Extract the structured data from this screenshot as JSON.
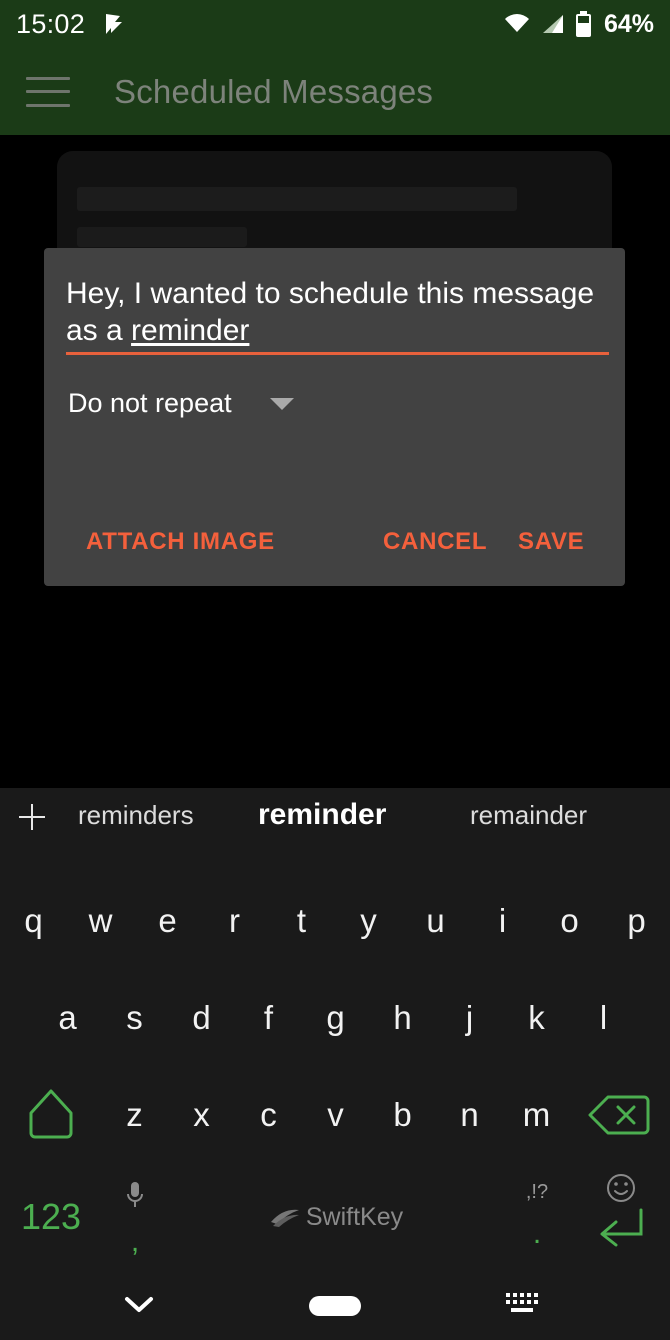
{
  "status_bar": {
    "clock": "15:02",
    "battery_percent": "64%",
    "icons": [
      "notification-flag-icon",
      "wifi-icon",
      "signal-icon",
      "battery-icon"
    ]
  },
  "app_bar": {
    "menu_icon": "hamburger-menu-icon",
    "title": "Scheduled Messages"
  },
  "dialog": {
    "message_text": "Hey, I wanted to schedule this message as a ",
    "composing_word": "reminder",
    "repeat_value": "Do not repeat",
    "repeat_caret_icon": "chevron-down-icon",
    "buttons": {
      "attach": "ATTACH IMAGE",
      "cancel": "CANCEL",
      "save": "SAVE"
    },
    "accent_underline_color": "#e8613c",
    "button_color": "#f4603c",
    "background_color": "#424242"
  },
  "keyboard": {
    "suggestions": [
      {
        "label": "reminders",
        "primary": false
      },
      {
        "label": "reminder",
        "primary": true
      },
      {
        "label": "remainder",
        "primary": false
      }
    ],
    "add_suggestion_icon": "plus-icon",
    "row1": [
      "q",
      "w",
      "e",
      "r",
      "t",
      "y",
      "u",
      "i",
      "o",
      "p"
    ],
    "row2": [
      "a",
      "s",
      "d",
      "f",
      "g",
      "h",
      "j",
      "k",
      "l"
    ],
    "row3": [
      "z",
      "x",
      "c",
      "v",
      "b",
      "n",
      "m"
    ],
    "shift_icon": "shift-key-icon",
    "backspace_icon": "backspace-key-icon",
    "numeric_key": "123",
    "comma_key": {
      "icon": "microphone-icon",
      "label": ","
    },
    "space_key": {
      "brand": "SwiftKey",
      "icon": "swiftkey-logo-icon"
    },
    "period_key": {
      "sub_label": ",!?",
      "label": "."
    },
    "enter_key": {
      "icon": "emoji-smiley-icon",
      "arrow_icon": "enter-return-icon"
    },
    "green_accent": "#4caf50",
    "background_color": "#1a1a1a"
  },
  "nav_bar": {
    "hide_keyboard_icon": "chevron-down-icon",
    "home_pill_icon": "home-pill-icon",
    "switch_keyboard_icon": "keyboard-switch-icon"
  }
}
